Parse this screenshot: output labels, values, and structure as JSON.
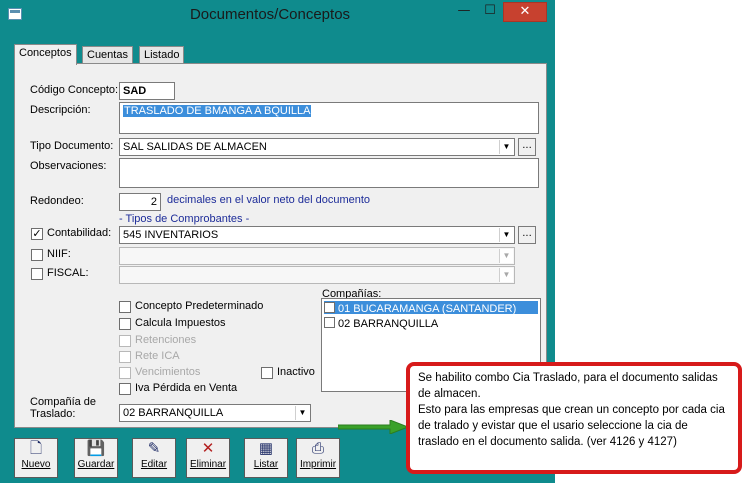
{
  "window": {
    "title": "Documentos/Conceptos",
    "min_glyph": "—",
    "max_glyph": "☐",
    "close_glyph": "✕"
  },
  "tabs": [
    {
      "label": "Conceptos",
      "active": true
    },
    {
      "label": "Cuentas",
      "active": false
    },
    {
      "label": "Listado",
      "active": false
    }
  ],
  "form": {
    "codigo_label": "Código Concepto:",
    "codigo_value": "SAD",
    "descripcion_label": "Descripción:",
    "descripcion_value": "TRASLADO DE BMANGA A BQUILLA",
    "tipo_doc_label": "Tipo Documento:",
    "tipo_doc_value": "SAL  SALIDAS DE ALMACEN",
    "observaciones_label": "Observaciones:",
    "redondeo_label": "Redondeo:",
    "redondeo_value": "2",
    "redondeo_hint": "decimales en el valor neto del documento",
    "tipos_comprobantes_label": "- Tipos de Comprobantes -",
    "contabilidad_label": "Contabilidad:",
    "contabilidad_value": "545  INVENTARIOS",
    "niif_label": "NIIF:",
    "fiscal_label": "FISCAL:",
    "concepto_pred_label": "Concepto Predeterminado",
    "calcula_imp_label": "Calcula Impuestos",
    "retenciones_label": "Retenciones",
    "rete_ica_label": "Rete ICA",
    "vencimientos_label": "Vencimientos",
    "inactivo_label": "Inactivo",
    "iva_perdida_label": "Iva Pérdida en Venta",
    "compania_traslado_label_1": "Compañía de",
    "compania_traslado_label_2": "Traslado:",
    "compania_traslado_value": "02  BARRANQUILLA",
    "companias_label": "Compañías:",
    "companias": [
      {
        "label": "01 BUCARAMANGA  (SANTANDER)",
        "selected": true
      },
      {
        "label": "02 BARRANQUILLA",
        "selected": false
      }
    ],
    "check_mark": "✓",
    "dropdown_glyph": "▼",
    "ellipsis_glyph": "..."
  },
  "toolbar": [
    {
      "label": "Nuevo",
      "icon": "new-document-icon",
      "glyph": "🗋"
    },
    {
      "label": "Guardar",
      "icon": "save-disk-icon",
      "glyph": "💾"
    },
    {
      "label": "Editar",
      "icon": "edit-icon",
      "glyph": "✎"
    },
    {
      "label": "Eliminar",
      "icon": "delete-x-icon",
      "glyph": "✕"
    },
    {
      "label": "Listar",
      "icon": "list-calendar-icon",
      "glyph": "▦"
    },
    {
      "label": "Imprimir",
      "icon": "printer-icon",
      "glyph": "⎙"
    }
  ],
  "callout": {
    "line1": "Se habilito combo Cia Traslado, para el documento salidas de almacen.",
    "line2": "Esto para las empresas que crean un concepto por cada cia de tralado y evistar que el usario seleccione  la cia de traslado en el documento salida. (ver 4126 y 4127)"
  },
  "colors": {
    "teal": "#0f8b8d",
    "close_red": "#c7412f",
    "callout_red": "#d71a1a",
    "link_blue": "#1d2c99",
    "selection_blue": "#3c8edb"
  }
}
